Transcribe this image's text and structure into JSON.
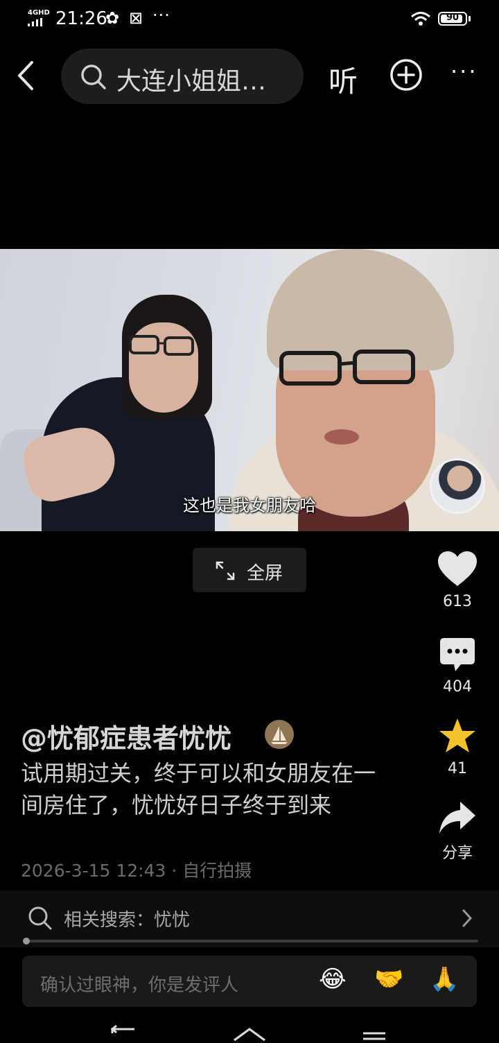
{
  "status_bar": {
    "network": "4GHD",
    "time": "21:26",
    "more": "···",
    "battery": "90",
    "battery_level": 0.9
  },
  "top_nav": {
    "search_text": "大连小姐姐…",
    "listen_label": "听"
  },
  "video": {
    "subtitle": "这也是我女朋友哈"
  },
  "fullscreen_label": "全屏",
  "actions": {
    "like_count": "613",
    "comment_count": "404",
    "favorite_count": "41",
    "share_label": "分享"
  },
  "post": {
    "author": "@忧郁症患者忧忧",
    "description": "试用期过关，终于可以和女朋友在一间房住了，忧忧好日子终于到来",
    "timestamp": "2026-3-15 12:43",
    "separator": "·",
    "source": "自行拍摄"
  },
  "related_search": {
    "label": "相关搜索：忧忧"
  },
  "playback": {
    "progress": 0.01
  },
  "comment_input": {
    "placeholder": "确认过眼神，你是发评人",
    "emojis": [
      "😂",
      "🤝",
      "🙏"
    ]
  },
  "colors": {
    "background": "#000000",
    "favorite_star": "#f4c22b"
  }
}
